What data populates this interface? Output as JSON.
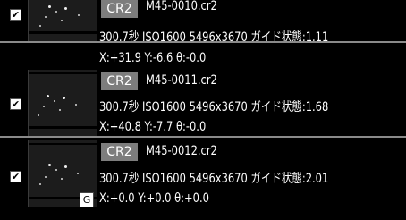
{
  "rows": [
    {
      "checked": "✔",
      "format_badge": "CR2",
      "filename": "M45-0010.cr2",
      "info": "300.7秒 ISO1600 5496x3670 ガイド状態:1.11",
      "coords": "X:+31.9 Y:-6.6 θ:-0.0",
      "guide_badge": ""
    },
    {
      "checked": "✔",
      "format_badge": "CR2",
      "filename": "M45-0011.cr2",
      "info": "300.7秒 ISO1600 5496x3670 ガイド状態:1.68",
      "coords": "X:+40.8 Y:-7.7 θ:-0.0",
      "guide_badge": ""
    },
    {
      "checked": "✔",
      "format_badge": "CR2",
      "filename": "M45-0012.cr2",
      "info": "300.7秒 ISO1600 5496x3670 ガイド状態:2.01",
      "coords": "X:+0.0 Y:+0.0 θ:+0.0",
      "guide_badge": "G"
    }
  ]
}
